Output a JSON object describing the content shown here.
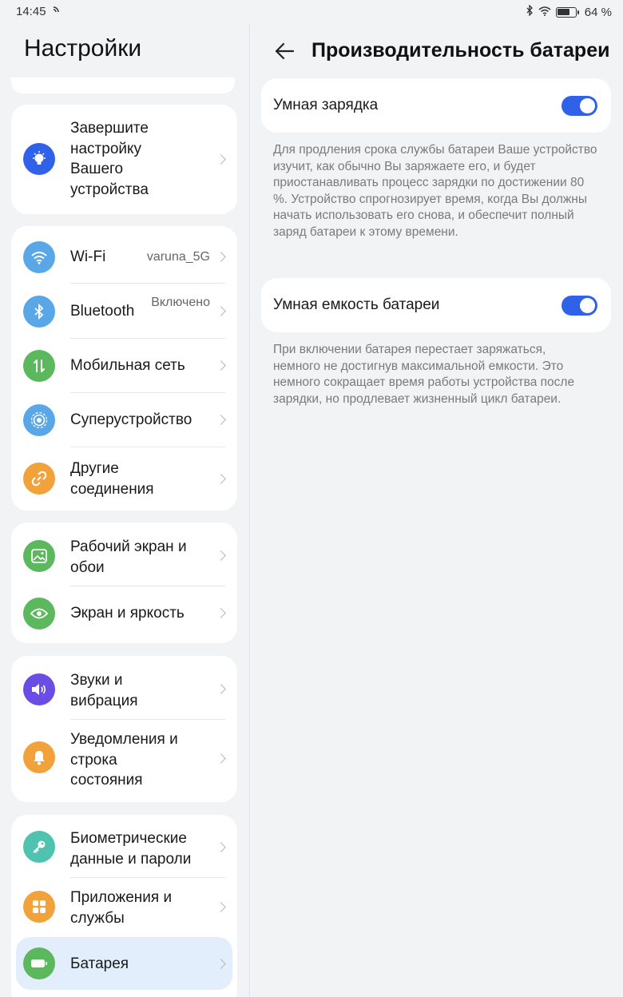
{
  "status_bar": {
    "time": "14:45",
    "battery_percent": "64 %",
    "icons": [
      "wifi-icon",
      "bluetooth-icon",
      "battery-icon"
    ]
  },
  "left": {
    "title": "Настройки",
    "setup_card": {
      "label": "Завершите настройку Вашего устройства",
      "icon": "lightbulb-icon",
      "color": "#2f62e8"
    },
    "groups": [
      {
        "items": [
          {
            "label": "Wi-Fi",
            "value": "varuna_5G",
            "icon": "wifi-icon",
            "color": "#5aa7e8"
          },
          {
            "label": "Bluetooth",
            "value": "Включено",
            "icon": "bluetooth-icon",
            "color": "#5aa7e8"
          },
          {
            "label": "Мобильная сеть",
            "value": "",
            "icon": "signal-icon",
            "color": "#5cb85c"
          },
          {
            "label": "Суперустройство",
            "value": "",
            "icon": "superdevice-icon",
            "color": "#5aa7e8"
          },
          {
            "label": "Другие соединения",
            "value": "",
            "icon": "link-icon",
            "color": "#f2a23a"
          }
        ]
      },
      {
        "items": [
          {
            "label": "Рабочий экран и обои",
            "icon": "wallpaper-icon",
            "color": "#5cb85c"
          },
          {
            "label": "Экран и яркость",
            "icon": "eye-icon",
            "color": "#5cb85c"
          }
        ]
      },
      {
        "items": [
          {
            "label": "Звуки и вибрация",
            "icon": "sound-icon",
            "color": "#6b4de6"
          },
          {
            "label": "Уведомления и строка состояния",
            "icon": "bell-icon",
            "color": "#f2a23a"
          }
        ]
      },
      {
        "items": [
          {
            "label": "Биометрические данные и пароли",
            "icon": "key-icon",
            "color": "#4fc3b0"
          },
          {
            "label": "Приложения и службы",
            "icon": "apps-icon",
            "color": "#f2a23a"
          },
          {
            "label": "Батарея",
            "icon": "battery-icon",
            "color": "#5cb85c",
            "selected": true
          }
        ]
      }
    ]
  },
  "right": {
    "title": "Производительность батареи",
    "settings": [
      {
        "label": "Умная зарядка",
        "enabled": true,
        "description": "Для продления срока службы батареи Ваше устройство изучит, как обычно Вы заряжаете его, и будет приостанавливать процесс зарядки по достижении 80 %. Устройство спрогнозирует время, когда Вы должны начать использовать его снова, и обеспечит полный заряд батареи к этому времени."
      },
      {
        "label": "Умная емкость батареи",
        "enabled": true,
        "description": "При включении батарея перестает заряжаться, немного не достигнув максимальной емкости. Это немного сокращает время работы устройства после зарядки, но продлевает жизненный цикл батареи."
      }
    ]
  }
}
